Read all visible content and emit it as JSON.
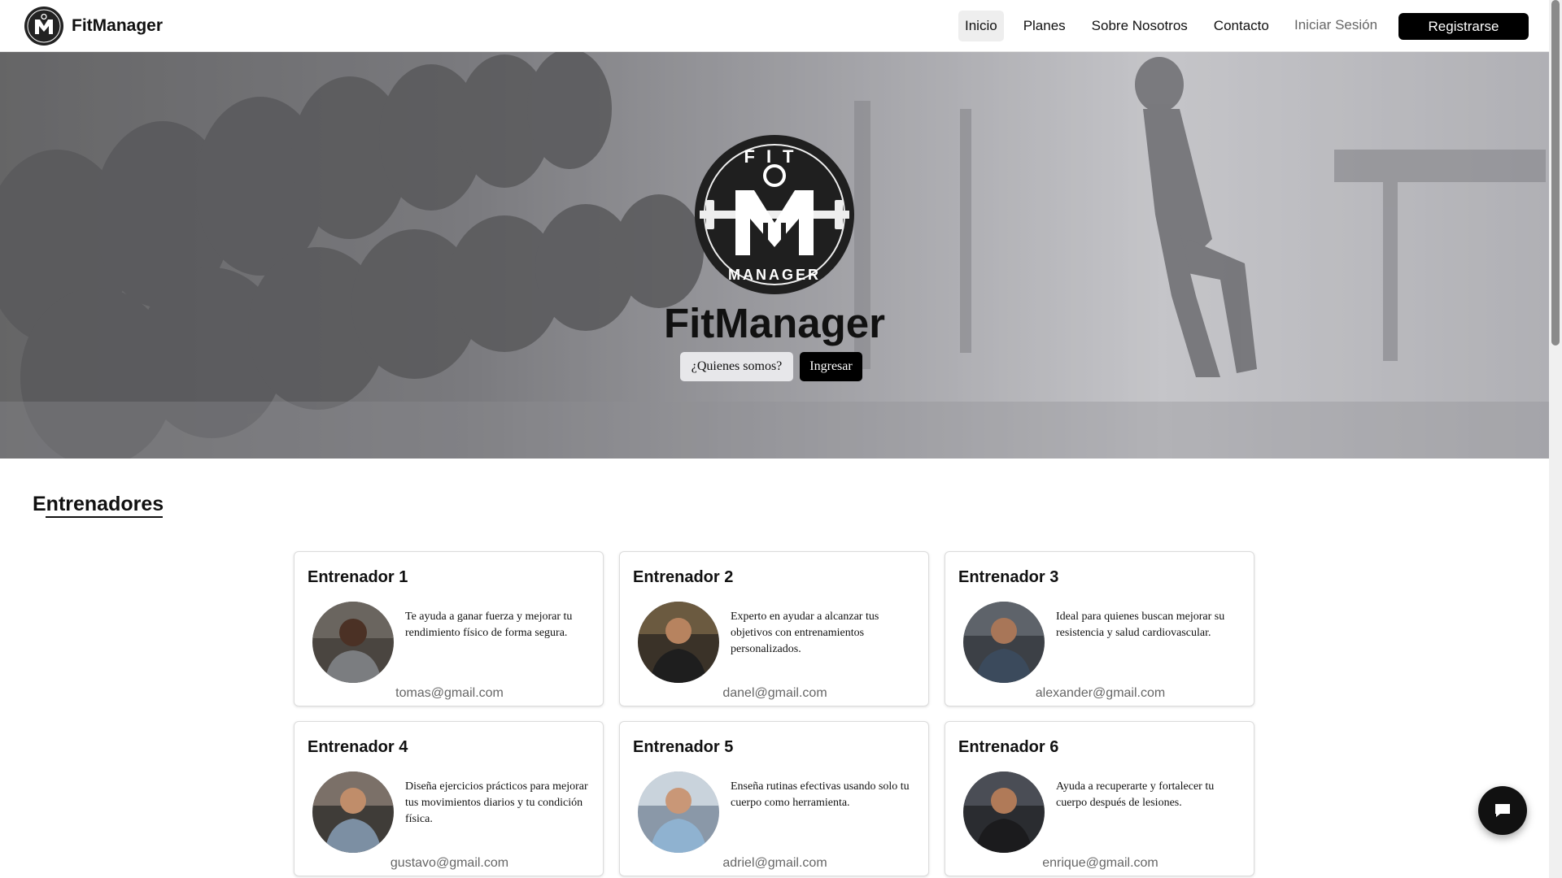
{
  "header": {
    "brand": "FitManager",
    "nav": [
      "Inicio",
      "Planes",
      "Sobre Nosotros",
      "Contacto"
    ],
    "login": "Iniciar Sesión",
    "register": "Registrarse"
  },
  "hero": {
    "logo_text_top": "FIT",
    "logo_text_bottom": "MANAGER",
    "title": "FitManager",
    "btn_about": "¿Quienes somos?",
    "btn_enter": "Ingresar"
  },
  "trainers": {
    "title": "Entrenadores",
    "cards": [
      {
        "name": "Entrenador 1",
        "desc": "Te ayuda a ganar fuerza y mejorar tu rendimiento físico de forma segura.",
        "email": "tomas@gmail.com"
      },
      {
        "name": "Entrenador 2",
        "desc": "Experto en ayudar a alcanzar tus objetivos con entrenamientos personalizados.",
        "email": "danel@gmail.com"
      },
      {
        "name": "Entrenador 3",
        "desc": "Ideal para quienes buscan mejorar su resistencia y salud cardiovascular.",
        "email": "alexander@gmail.com"
      },
      {
        "name": "Entrenador 4",
        "desc": "Diseña ejercicios prácticos para mejorar tus movimientos diarios y tu condición física.",
        "email": "gustavo@gmail.com"
      },
      {
        "name": "Entrenador 5",
        "desc": "Enseña rutinas efectivas usando solo tu cuerpo como herramienta.",
        "email": "adriel@gmail.com"
      },
      {
        "name": "Entrenador 6",
        "desc": "Ayuda a recuperarte y fortalecer tu cuerpo después de lesiones.",
        "email": "enrique@gmail.com"
      }
    ]
  },
  "icons": {
    "chat": "chat-bubble-icon",
    "logo": "fitmanager-logo-icon"
  },
  "colors": {
    "primary": "#000000",
    "nav_active_bg": "#eeeeee",
    "muted_text": "#666666"
  }
}
